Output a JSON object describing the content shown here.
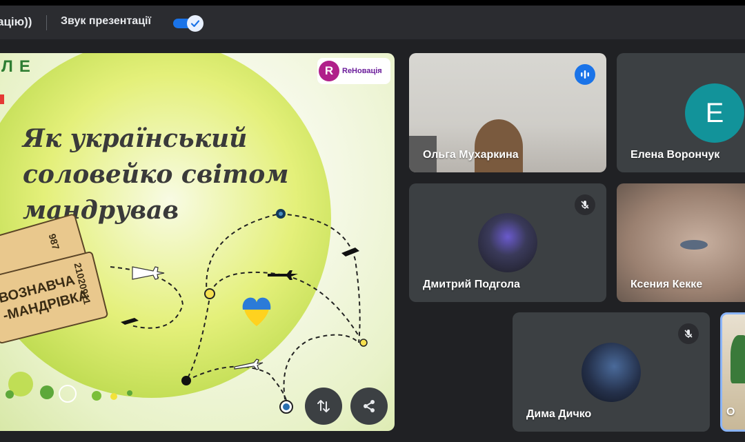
{
  "topbar": {
    "cut_label": "ацію))",
    "sound_label": "Звук презентації",
    "toggle_on": true
  },
  "presentation": {
    "title_lines": [
      "Як український",
      "соловейко світом",
      "мандрував"
    ],
    "brand": "ReНовація",
    "brand_letter": "R",
    "letters": "ЛЕ",
    "ticket_lines": [
      "ВОЗНАВЧА",
      "-МАНДРІВКА"
    ],
    "ticket_number": "21020911",
    "ticket_number2": "987"
  },
  "participants": [
    {
      "name": "Ольга Мухаркина",
      "speaking": true
    },
    {
      "name": "Елена Ворончук",
      "initial": "E",
      "avatar_color": "#12939a"
    },
    {
      "name": "Дмитрий Подгола",
      "muted": true
    },
    {
      "name": "Ксения Кекке"
    },
    {
      "name": "Дима Дичко",
      "muted": true
    },
    {
      "name": "О"
    }
  ],
  "icons": {
    "toggle": "check-icon",
    "swap": "swap-vertical-icon",
    "share": "share-icon",
    "mic_off": "mic-off-icon",
    "speaking": "audio-level-icon"
  }
}
